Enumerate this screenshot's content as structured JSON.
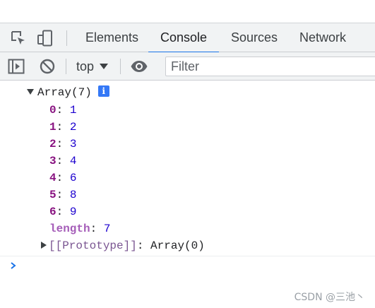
{
  "tabs": [
    {
      "label": "Elements",
      "active": false
    },
    {
      "label": "Console",
      "active": true
    },
    {
      "label": "Sources",
      "active": false
    },
    {
      "label": "Network",
      "active": false
    }
  ],
  "toolbar": {
    "context": "top",
    "filter_placeholder": "Filter"
  },
  "icons": {
    "inspect": "inspect-element-icon",
    "device": "device-toolbar-icon",
    "sidebar": "show-sidebar-icon",
    "clear": "clear-console-icon",
    "eye": "live-expression-icon"
  },
  "console_output": {
    "header": "Array(7)",
    "info_badge": "i",
    "entries": [
      {
        "key": "0",
        "value": "1"
      },
      {
        "key": "1",
        "value": "2"
      },
      {
        "key": "2",
        "value": "3"
      },
      {
        "key": "3",
        "value": "4"
      },
      {
        "key": "4",
        "value": "6"
      },
      {
        "key": "5",
        "value": "8"
      },
      {
        "key": "6",
        "value": "9"
      }
    ],
    "length_key": "length",
    "length_value": "7",
    "prototype_key": "[[Prototype]]",
    "prototype_value": "Array(0)"
  },
  "watermark": "CSDN @三池丶",
  "colors": {
    "accent": "#1a73e8",
    "key": "#881280",
    "number": "#1c00cf",
    "length_key": "#a55db8",
    "info_badge": "#3478f6"
  }
}
